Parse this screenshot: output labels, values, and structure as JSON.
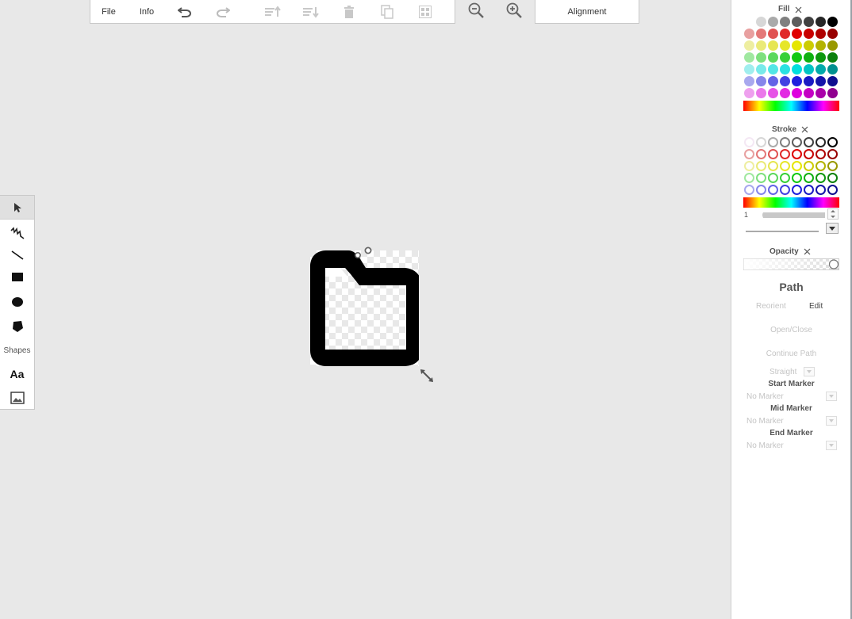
{
  "toolbar": {
    "file_label": "File",
    "info_label": "Info",
    "alignment_label": "Alignment"
  },
  "tools": {
    "shapes_label": "Shapes",
    "text_label": "Aa"
  },
  "panel": {
    "fill_title": "Fill",
    "stroke_title": "Stroke",
    "stroke_width": "1",
    "opacity_title": "Opacity",
    "element_title": "Path",
    "reorient_label": "Reorient",
    "edit_label": "Edit",
    "open_close_label": "Open/Close",
    "continue_path_label": "Continue Path",
    "straight_label": "Straight",
    "start_marker_title": "Start Marker",
    "start_marker_value": "No Marker",
    "mid_marker_title": "Mid Marker",
    "mid_marker_value": "No Marker",
    "end_marker_title": "End Marker",
    "end_marker_value": "No Marker"
  },
  "fill_colors": [
    [
      "#ffffff",
      "#d7d7d7",
      "#aaaaaa",
      "#808080",
      "#5d5d5d",
      "#404040",
      "#262626",
      "#000000"
    ],
    [
      "#e8a0a0",
      "#e47878",
      "#e05252",
      "#e02a2a",
      "#e00000",
      "#c80000",
      "#b00000",
      "#980000"
    ],
    [
      "#eeeea0",
      "#eaea78",
      "#e6e652",
      "#e6e62a",
      "#e6e600",
      "#cccc00",
      "#b3b300",
      "#999900"
    ],
    [
      "#a0e8a0",
      "#7ee07e",
      "#5cd85c",
      "#38d038",
      "#12c812",
      "#10b010",
      "#0e980e",
      "#0c800c"
    ],
    [
      "#a0eeee",
      "#78eaea",
      "#52e6e6",
      "#2ae2e2",
      "#00dede",
      "#00c4c4",
      "#00aaaa",
      "#009090"
    ],
    [
      "#a8a8ee",
      "#8686ea",
      "#6464e6",
      "#4242e2",
      "#2020de",
      "#1a1ac4",
      "#1414aa",
      "#0e0e90"
    ],
    [
      "#eea0ee",
      "#ea78ea",
      "#e652e6",
      "#e22ae2",
      "#de00de",
      "#c400c4",
      "#aa00aa",
      "#900090"
    ]
  ],
  "stroke_colors": [
    [
      "#f4e8f4",
      "#d7d7d7",
      "#aaaaaa",
      "#808080",
      "#5d5d5d",
      "#404040",
      "#262626",
      "#000000"
    ],
    [
      "#e8a0a0",
      "#e47878",
      "#e05252",
      "#e02a2a",
      "#e00000",
      "#c80000",
      "#b00000",
      "#980000"
    ],
    [
      "#eeeea0",
      "#eaea78",
      "#e6e652",
      "#e6e62a",
      "#e6e600",
      "#cccc00",
      "#b3b300",
      "#999900"
    ],
    [
      "#a0e8a0",
      "#7ee07e",
      "#5cd85c",
      "#38d038",
      "#12c812",
      "#10b010",
      "#0e980e",
      "#0c800c"
    ],
    [
      "#a8a8ee",
      "#8686ea",
      "#6464e6",
      "#4242e2",
      "#2020de",
      "#1a1ac4",
      "#1414aa",
      "#0e0e90"
    ]
  ]
}
